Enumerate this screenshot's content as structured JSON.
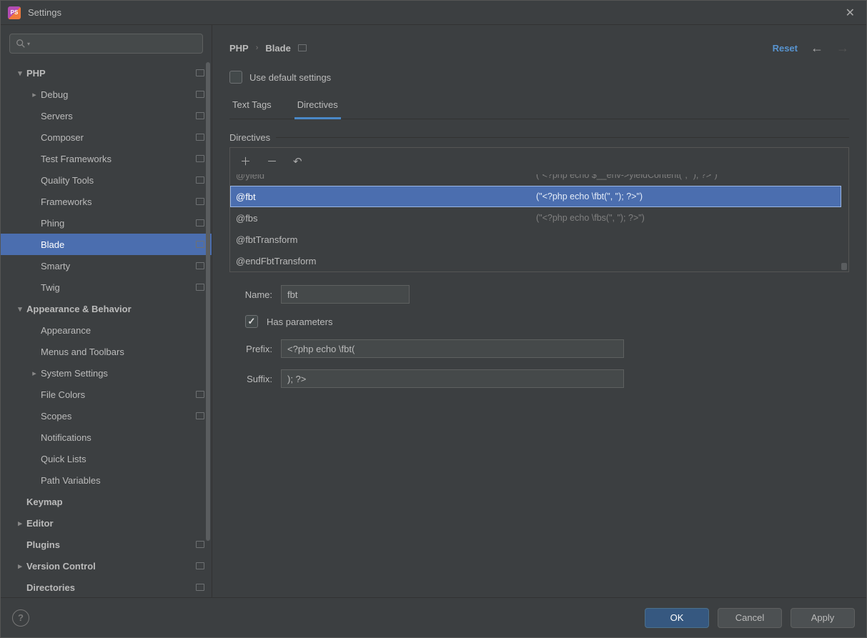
{
  "window": {
    "title": "Settings"
  },
  "sidebar": {
    "groups": [
      {
        "label": "PHP",
        "depth": 0,
        "arrow": "down",
        "bold": true,
        "editIcon": true
      },
      {
        "label": "Debug",
        "depth": 1,
        "arrow": "right",
        "editIcon": true
      },
      {
        "label": "Servers",
        "depth": 1,
        "editIcon": true
      },
      {
        "label": "Composer",
        "depth": 1,
        "editIcon": true
      },
      {
        "label": "Test Frameworks",
        "depth": 1,
        "editIcon": true
      },
      {
        "label": "Quality Tools",
        "depth": 1,
        "editIcon": true
      },
      {
        "label": "Frameworks",
        "depth": 1,
        "editIcon": true
      },
      {
        "label": "Phing",
        "depth": 1,
        "editIcon": true
      },
      {
        "label": "Blade",
        "depth": 1,
        "editIcon": true,
        "selected": true
      },
      {
        "label": "Smarty",
        "depth": 1,
        "editIcon": true
      },
      {
        "label": "Twig",
        "depth": 1,
        "editIcon": true
      },
      {
        "label": "Appearance & Behavior",
        "depth": 0,
        "arrow": "down",
        "bold": true
      },
      {
        "label": "Appearance",
        "depth": 1
      },
      {
        "label": "Menus and Toolbars",
        "depth": 1
      },
      {
        "label": "System Settings",
        "depth": 1,
        "arrow": "right"
      },
      {
        "label": "File Colors",
        "depth": 1,
        "editIcon": true
      },
      {
        "label": "Scopes",
        "depth": 1,
        "editIcon": true
      },
      {
        "label": "Notifications",
        "depth": 1
      },
      {
        "label": "Quick Lists",
        "depth": 1
      },
      {
        "label": "Path Variables",
        "depth": 1
      },
      {
        "label": "Keymap",
        "depth": 0,
        "bold": true
      },
      {
        "label": "Editor",
        "depth": 0,
        "arrow": "right",
        "bold": true
      },
      {
        "label": "Plugins",
        "depth": 0,
        "bold": true,
        "editIcon": true
      },
      {
        "label": "Version Control",
        "depth": 0,
        "arrow": "right",
        "bold": true,
        "editIcon": true
      },
      {
        "label": "Directories",
        "depth": 0,
        "bold": true,
        "editIcon": true
      }
    ]
  },
  "breadcrumb": {
    "a": "PHP",
    "b": "Blade"
  },
  "resetLabel": "Reset",
  "useDefault": {
    "label": "Use default settings",
    "checked": false
  },
  "tabs": {
    "a": "Text Tags",
    "b": "Directives",
    "active": "b"
  },
  "directives": {
    "title": "Directives",
    "rows": [
      {
        "name": "@yield",
        "expansion": "(\"<?php echo $__env->yieldContent(\", \"); ?>\")",
        "partial": true
      },
      {
        "name": "@fbt",
        "expansion": "(\"<?php echo \\fbt(\", \"); ?>\")",
        "selected": true
      },
      {
        "name": "@fbs",
        "expansion": "(\"<?php echo \\fbs(\", \"); ?>\")"
      },
      {
        "name": "@fbtTransform",
        "expansion": ""
      },
      {
        "name": "@endFbtTransform",
        "expansion": ""
      }
    ]
  },
  "form": {
    "nameLabel": "Name:",
    "nameValue": "fbt",
    "hasParamsLabel": "Has parameters",
    "hasParamsChecked": true,
    "prefixLabel": "Prefix:",
    "prefixValue": "<?php echo \\fbt(",
    "suffixLabel": "Suffix:",
    "suffixValue": "); ?>"
  },
  "buttons": {
    "ok": "OK",
    "cancel": "Cancel",
    "apply": "Apply"
  }
}
